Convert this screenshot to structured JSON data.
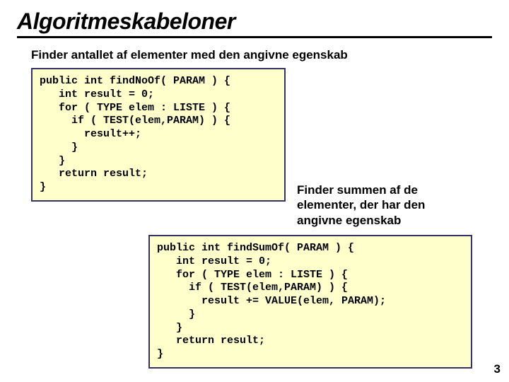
{
  "title": "Algoritmeskabeloner",
  "subtitle1": "Finder antallet af elementer med den angivne egenskab",
  "subtitle2": "Finder summen af de elementer, der har den angivne egenskab",
  "code1": "public int findNoOf( PARAM ) {\n   int result = 0;\n   for ( TYPE elem : LISTE ) {\n     if ( TEST(elem,PARAM) ) {\n       result++;\n     }\n   }\n   return result;\n}",
  "code2": "public int findSumOf( PARAM ) {\n   int result = 0;\n   for ( TYPE elem : LISTE ) {\n     if ( TEST(elem,PARAM) ) {\n       result += VALUE(elem, PARAM);\n     }\n   }\n   return result;\n}",
  "page_number": "3"
}
